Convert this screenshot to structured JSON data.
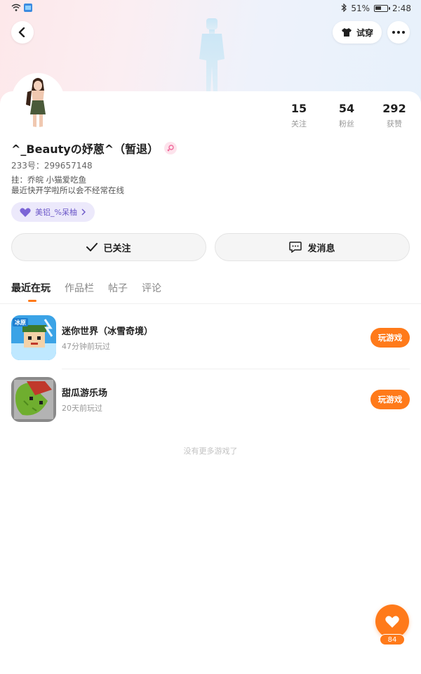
{
  "status_bar": {
    "battery": "51%",
    "battery_level": 0.51,
    "time": "2:48"
  },
  "header": {
    "try_on_label": "试穿"
  },
  "profile": {
    "name": "^_Beautyの妤蒽^（暂退）",
    "uid": "233号：299657148",
    "bio_line1": "挂：乔皖   小猫爱吃鱼",
    "bio_line2": "最近快开学啦所以会不经常在线",
    "tag_label": "美铝_%呆柚"
  },
  "stats": [
    {
      "value": "15",
      "label": "关注"
    },
    {
      "value": "54",
      "label": "粉丝"
    },
    {
      "value": "292",
      "label": "获赞"
    }
  ],
  "actions": {
    "follow_label": "已关注",
    "message_label": "发消息"
  },
  "tabs": [
    {
      "label": "最近在玩",
      "active": true
    },
    {
      "label": "作品栏",
      "active": false
    },
    {
      "label": "帖子",
      "active": false
    },
    {
      "label": "评论",
      "active": false
    }
  ],
  "games": [
    {
      "title": "迷你世界（冰雪奇境）",
      "time": "47分钟前玩过",
      "button": "玩游戏",
      "icon_badge": "冰原"
    },
    {
      "title": "甜瓜游乐场",
      "time": "20天前玩过",
      "button": "玩游戏"
    }
  ],
  "empty_hint": "没有更多游戏了",
  "like": {
    "count": "84"
  },
  "colors": {
    "accent": "#ff7a1a",
    "tag_bg": "#ece9fb",
    "tag_text": "#6b57c8"
  }
}
